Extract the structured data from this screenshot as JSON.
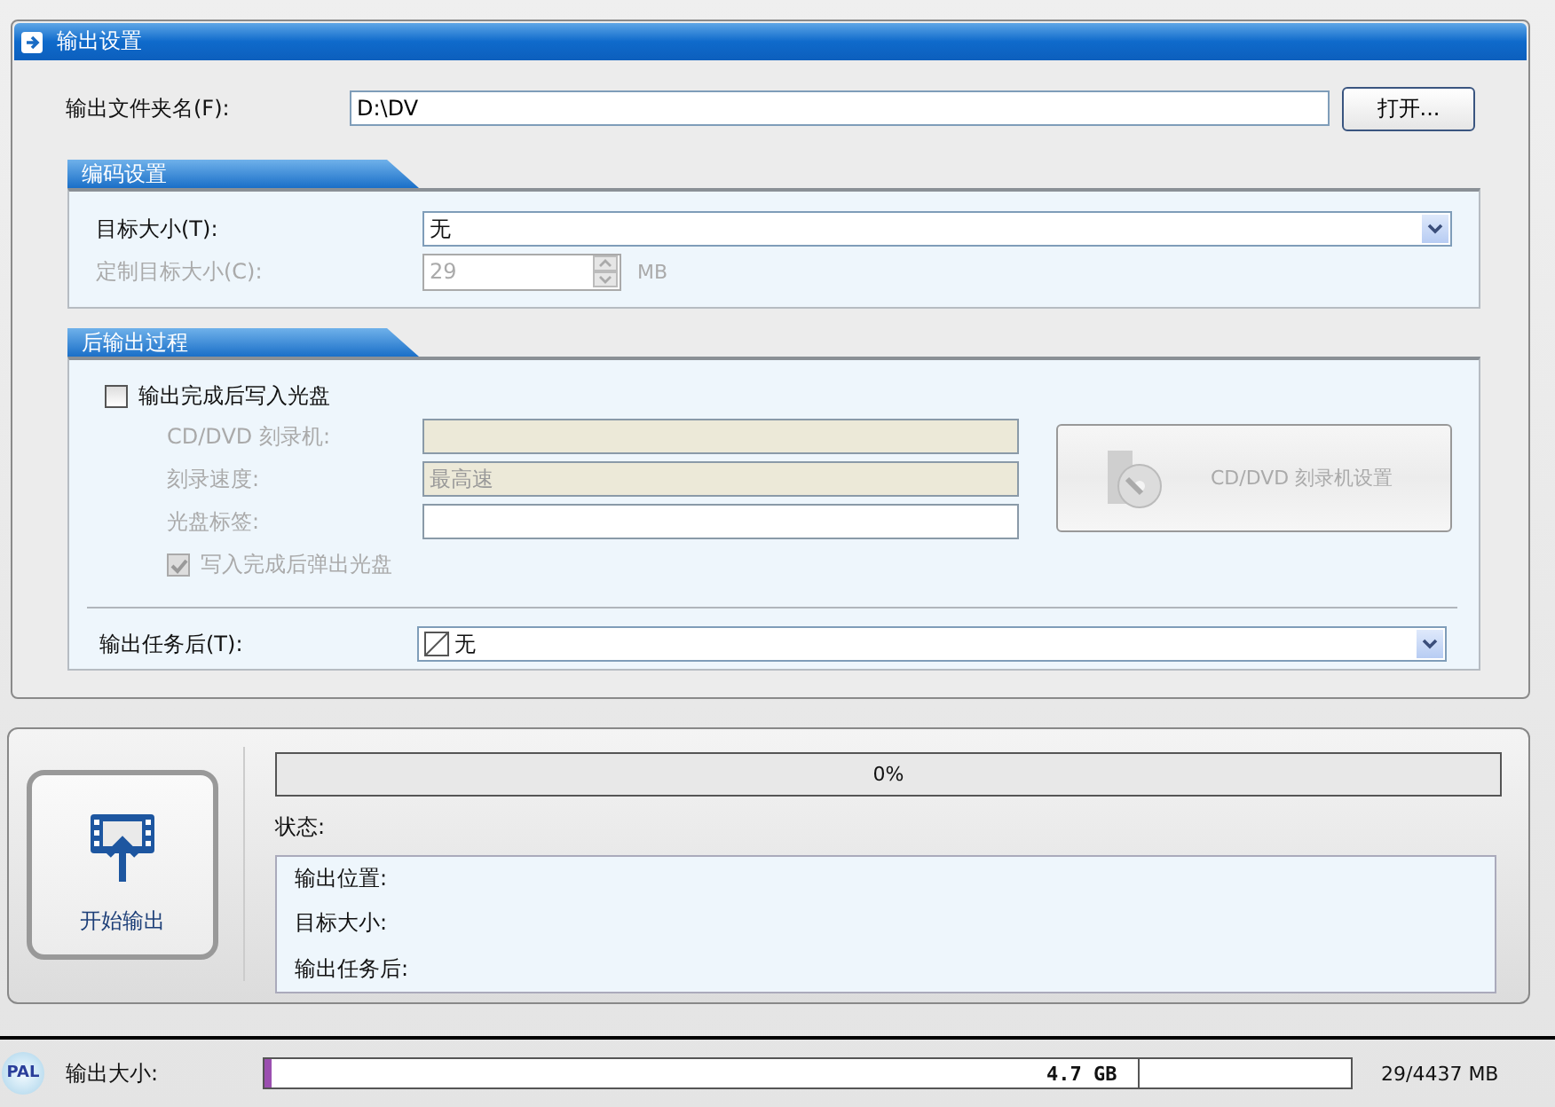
{
  "panel": {
    "title": "输出设置",
    "folder": {
      "label": "输出文件夹名(F):",
      "value": "D:\\DV",
      "button": "打开..."
    },
    "encoding": {
      "title": "编码设置",
      "target_size": {
        "label": "目标大小(T):",
        "value": "无"
      },
      "custom_size": {
        "label": "定制目标大小(C):",
        "value": "29",
        "unit": "MB",
        "disabled": true
      }
    },
    "post": {
      "title": "后输出过程",
      "burn": {
        "label": "输出完成后写入光盘",
        "checked": false
      },
      "fields": [
        {
          "label": "CD/DVD 刻录机:",
          "kind": "select",
          "disabled": true
        },
        {
          "label": "刻录速度:",
          "kind": "select",
          "value": "最高速",
          "disabled": true
        },
        {
          "label": "光盘标签:",
          "kind": "text",
          "disabled": true
        }
      ],
      "eject": {
        "label": "写入完成后弹出光盘",
        "checked": true,
        "disabled": true
      },
      "burner_button": {
        "label": "CD/DVD 刻录机设置",
        "disabled": true
      },
      "after_task": {
        "label": "输出任务后(T):",
        "value": "无"
      }
    }
  },
  "output": {
    "start_button": "开始输出",
    "progress": {
      "level": 0,
      "text": "0%"
    },
    "status_label": "状态:",
    "status_lines": [
      "输出位置:",
      "目标大小:",
      "输出任务后:"
    ]
  },
  "status_bar": {
    "format": "PAL",
    "label": "输出大小:",
    "capacity": "4.7 GB",
    "usage": "29/4437 MB",
    "level": 0.007
  }
}
